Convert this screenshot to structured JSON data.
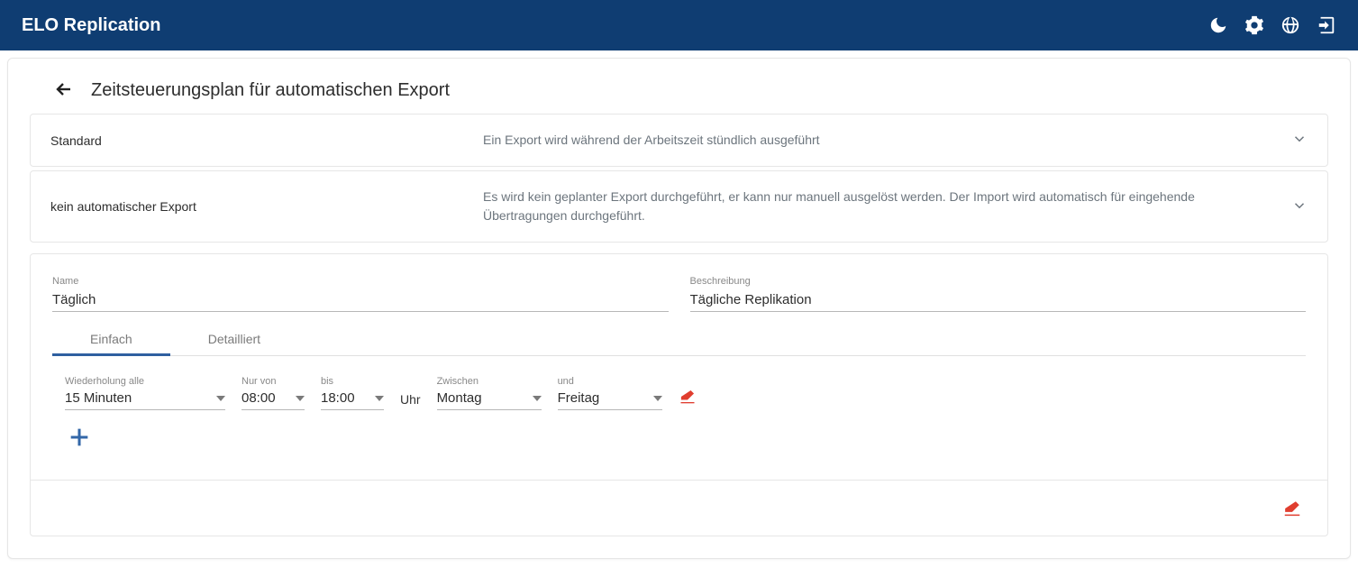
{
  "app": {
    "title": "ELO Replication"
  },
  "page": {
    "title": "Zeitsteuerungsplan für automatischen Export"
  },
  "accordions": [
    {
      "name": "Standard",
      "desc": "Ein Export wird während der Arbeitszeit stündlich ausgeführt"
    },
    {
      "name": "kein automatischer Export",
      "desc": "Es wird kein geplanter Export durchgeführt, er kann nur manuell ausgelöst werden. Der Import wird automatisch für eingehende Übertragungen durchgeführt."
    }
  ],
  "editor": {
    "fields": {
      "name_label": "Name",
      "name_value": "Täglich",
      "desc_label": "Beschreibung",
      "desc_value": "Tägliche Replikation"
    },
    "tabs": {
      "simple": "Einfach",
      "detailed": "Detailliert"
    },
    "schedule": {
      "repeat_label": "Wiederholung alle",
      "repeat_value": "15 Minuten",
      "from_label": "Nur von",
      "from_value": "08:00",
      "to_label": "bis",
      "to_value": "18:00",
      "clock_unit": "Uhr",
      "between_label": "Zwischen",
      "between_value": "Montag",
      "and_label": "und",
      "and_value": "Freitag"
    }
  }
}
